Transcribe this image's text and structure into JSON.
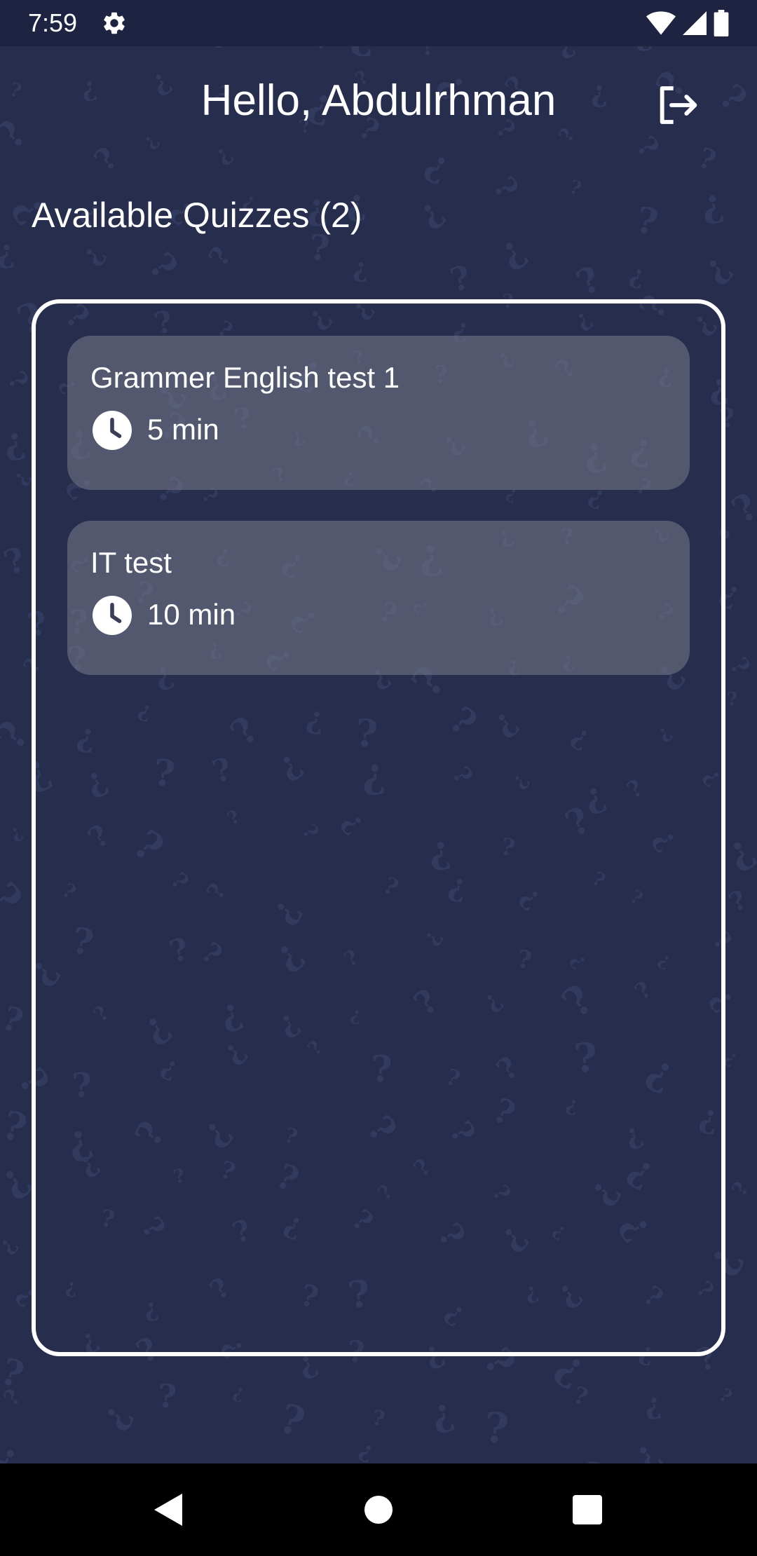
{
  "status_bar": {
    "time": "7:59",
    "icons": [
      "gear-icon",
      "wifi-icon",
      "signal-icon",
      "battery-icon"
    ]
  },
  "header": {
    "greeting": "Hello, Abdulrhman",
    "logout_icon": "logout-icon"
  },
  "section": {
    "title": "Available Quizzes (2)"
  },
  "quizzes": [
    {
      "title": "Grammer English test 1",
      "duration": "5 min",
      "icon": "clock-icon"
    },
    {
      "title": "IT test",
      "duration": "10 min",
      "icon": "clock-icon"
    }
  ],
  "nav_bar": {
    "buttons": [
      "back-icon",
      "home-icon",
      "recents-icon"
    ]
  },
  "colors": {
    "background": "#262d4d",
    "status_bar": "#1d2340",
    "card": "#5a5f75",
    "text": "#ffffff"
  }
}
